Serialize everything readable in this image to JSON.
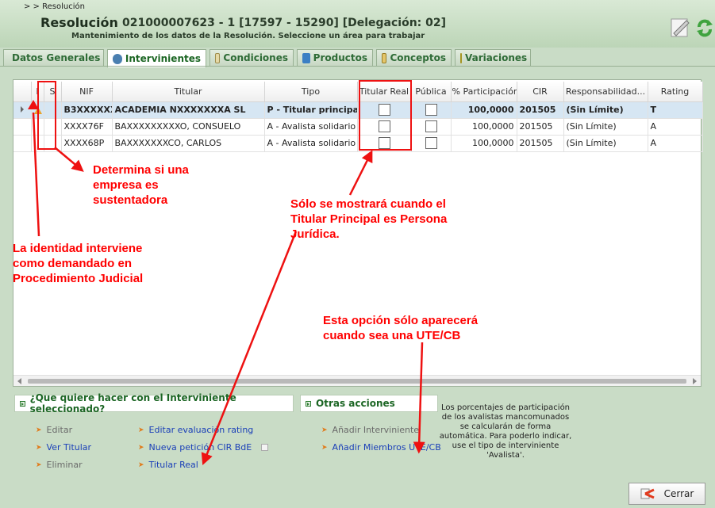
{
  "header": {
    "breadcrumb": ">  > Resolución",
    "title": "Resolución",
    "id_line": "021000007623 - 1 [17597 - 15290] [Delegación: 02]",
    "subtitle": "Mantenimiento de los datos de la Resolución. Seleccione un área para trabajar"
  },
  "tabs": [
    {
      "label": "Datos Generales",
      "icon": "document-r-icon",
      "active": false
    },
    {
      "label": "Intervinientes",
      "icon": "person-icon",
      "active": true
    },
    {
      "label": "Condiciones",
      "icon": "conditions-icon",
      "active": false
    },
    {
      "label": "Productos",
      "icon": "cube-icon",
      "active": false
    },
    {
      "label": "Conceptos",
      "icon": "list-icon",
      "active": false
    },
    {
      "label": "Variaciones",
      "icon": "pencil-icon",
      "active": false
    }
  ],
  "grid": {
    "columns": [
      "I",
      "S",
      "NIF",
      "Titular",
      "Tipo",
      "Titular Real",
      "Pública",
      "% Participación",
      "CIR",
      "Responsabilidad...",
      "Rating"
    ],
    "rows": [
      {
        "nif": "B3XXXXXX",
        "titular": "ACADEMIA NXXXXXXXA SL",
        "tipo": "P - Titular principal",
        "participacion": "100,0000",
        "cir": "201505",
        "responsabilidad": "(Sin Límite)",
        "rating": "T"
      },
      {
        "nif": "XXXX76F",
        "titular": "BAXXXXXXXXXO, CONSUELO",
        "tipo": "A - Avalista solidario",
        "participacion": "100,0000",
        "cir": "201505",
        "responsabilidad": "(Sin Límite)",
        "rating": "A"
      },
      {
        "nif": "XXXX68P",
        "titular": "BAXXXXXXXCO, CARLOS",
        "tipo": "A - Avalista solidario",
        "participacion": "100,0000",
        "cir": "201505",
        "responsabilidad": "(Sin Límite)",
        "rating": "A"
      }
    ]
  },
  "actions": {
    "section_title": "¿Que quiere hacer con el Interviniente seleccionado?",
    "editar": "Editar",
    "ver_titular": "Ver Titular",
    "eliminar": "Eliminar",
    "editar_rating": "Editar evaluación rating",
    "nueva_peticion": "Nueva petición CIR BdE",
    "titular_real": "Titular Real"
  },
  "otras": {
    "section_title": "Otras acciones",
    "anadir_interviniente": "Añadir Interviniente",
    "anadir_miembros": "Añadir Miembros UTE/CB"
  },
  "note": "Los porcentajes de participación de los avalistas mancomunados se calcularán de forma automática. Para poderlo indicar, use el tipo de interviniente 'Avalista'.",
  "close_label": "Cerrar",
  "annotations": {
    "sustentadora": "Determina si una empresa es sustentadora",
    "titular_real": "Sólo se mostrará cuando el Titular Principal es Persona Jurídica.",
    "demandado": "La identidad interviene como demandado en Procedimiento Judicial",
    "ute": "Esta opción sólo aparecerá cuando sea una UTE/CB"
  },
  "colors": {
    "accent_green": "#1c6624",
    "annotation_red": "#ff0000",
    "link_blue": "#1a3fb8"
  }
}
